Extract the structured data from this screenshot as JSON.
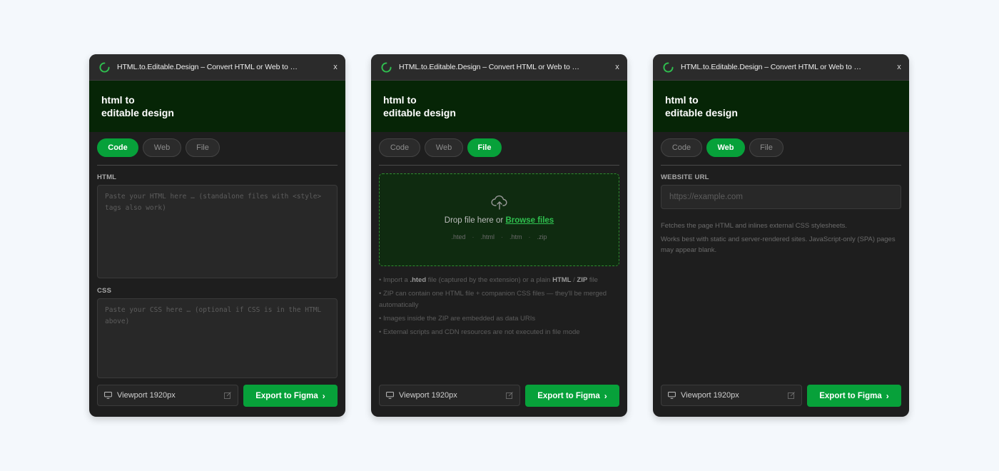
{
  "app": {
    "title": "HTML.to.Editable.Design – Convert HTML or Web to …",
    "close": "x",
    "hero_line1": "html to",
    "hero_line2": "editable design",
    "accent": "#07a13a",
    "hero_bg": "#062506"
  },
  "tabs": {
    "code": "Code",
    "web": "Web",
    "file": "File"
  },
  "code_panel": {
    "html_label": "HTML",
    "html_placeholder": "Paste your HTML here … (standalone files with <style> tags also work)",
    "css_label": "CSS",
    "css_placeholder": "Paste your CSS here … (optional if CSS is in the HTML above)"
  },
  "file_panel": {
    "drop_text": "Drop file here or",
    "browse": "Browse files",
    "extensions": [
      ".hted",
      ".html",
      ".htm",
      ".zip"
    ],
    "separator": "·",
    "note1_pre": "• Import a",
    "note1_hted": ".hted",
    "note1_mid": "file (captured by the extension) or a plain",
    "note1_html": "HTML",
    "note1_slash": "/",
    "note1_zip": "ZIP",
    "note1_post": "file",
    "note2": "• ZIP can contain one HTML file + companion CSS files — they'll be merged automatically",
    "note3": "• Images inside the ZIP are embedded as data URIs",
    "note4": "• External scripts and CDN resources are not executed in file mode"
  },
  "web_panel": {
    "url_label": "WEBSITE URL",
    "url_placeholder": "https://example.com",
    "info1": "Fetches the page HTML and inlines external CSS stylesheets.",
    "info2": "Works best with static and server-rendered sites. JavaScript-only (SPA) pages may appear blank."
  },
  "footer": {
    "viewport": "Viewport 1920px",
    "export": "Export to Figma",
    "chevron": "›"
  }
}
